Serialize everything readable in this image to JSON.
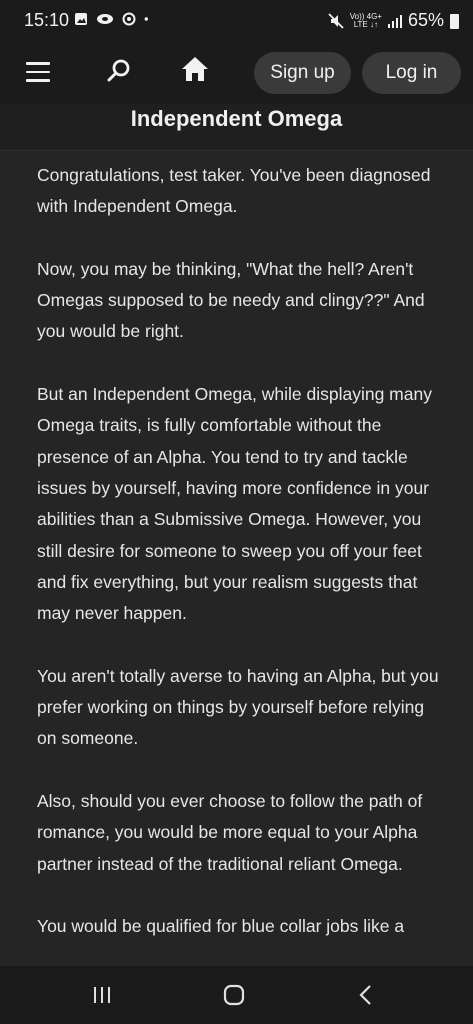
{
  "status_bar": {
    "time": "15:10",
    "network_top": "Vo)) 4G+",
    "network_bottom": "LTE ↓↑",
    "battery": "65%"
  },
  "header": {
    "signup_label": "Sign up",
    "login_label": "Log in"
  },
  "page": {
    "title": "Independent Omega"
  },
  "content": {
    "paragraphs": [
      "Congratulations, test taker. You've been diagnosed with Independent Omega.",
      "Now, you may be thinking, \"What the hell? Aren't Omegas supposed to be needy and clingy??\" And you would be right.",
      "But an Independent Omega, while displaying many Omega traits, is fully comfortable without the presence of an Alpha. You tend to try and tackle issues by yourself, having more confidence in your abilities than a Submissive Omega. However, you still desire for someone to sweep you off your feet and fix everything, but your realism suggests that may never happen.",
      "You aren't totally averse to having an Alpha, but you prefer working on things by yourself before relying on someone.",
      "Also, should you ever choose to follow the path of romance, you would be more equal to your Alpha partner instead of the traditional reliant Omega.",
      "You would be qualified for blue collar jobs like a"
    ]
  },
  "icons": {
    "menu": "menu-icon",
    "search": "search-icon",
    "home": "home-icon",
    "nav_recent": "recent-apps-icon",
    "nav_home": "nav-home-icon",
    "nav_back": "back-icon"
  },
  "colors": {
    "background": "#252525",
    "header": "#1b1b1b",
    "button": "#3a3a3a",
    "text": "#e6e6e6"
  }
}
